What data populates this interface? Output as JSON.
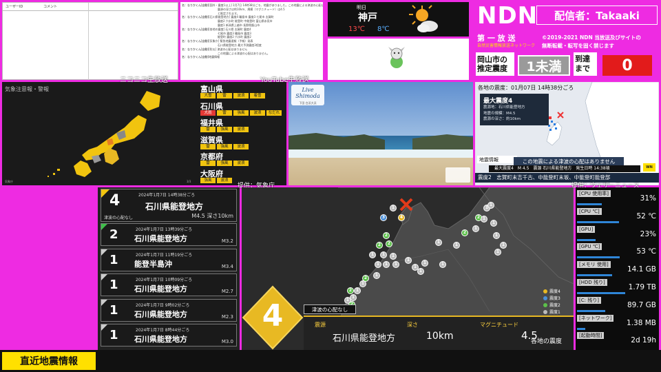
{
  "comments": {
    "col_user": "ユーザーID",
    "col_comment": "コメント"
  },
  "log": [
    {
      "who": "名：なりかくん[自動]",
      "text": "[国外・震度1以上] 1月7日 14時38分ごろ、地震がありました。この地震による津波の心配はありません。"
    },
    {
      "who": "",
      "text": "　　　　　　　　　　　　　震源の深さは約10km、規模（マグニチュード）は4.5"
    },
    {
      "who": "",
      "text": "　　　　　　　　　　　　　と推定されます。"
    },
    {
      "who": "名：なりかくん[自動]",
      "text": "[石川県能登地方] 震度4 輪島市 震度3 七尾市 志賀町"
    },
    {
      "who": "",
      "text": "　　　　　　　　　　　　　震度2 穴水町 能登町 中能登町 富山県氷見市"
    },
    {
      "who": "",
      "text": "　　　　　　　　　　　　　震度1 新潟県上越市 長野県飯山市"
    },
    {
      "who": "名：なりかくん[自動]",
      "text": "[各地の震度] 石川県 志賀町 震度4"
    },
    {
      "who": "",
      "text": "　　　　　　　　　　　　　七尾市 震度3 輪島市 震度3"
    },
    {
      "who": "",
      "text": "　　　　　　　　　　　　　能登町 震度2 穴水町 震度2"
    },
    {
      "who": "名：なりかくん[自動]",
      "text": "[気象庁] 緊急地震速報（予報）発表"
    },
    {
      "who": "",
      "text": "　　　　　　　　　　　　　石川県能登地方 最大予測震度3程度"
    },
    {
      "who": "名：なりかくん[自動]",
      "text": "[防災] 津波の心配はありません"
    },
    {
      "who": "",
      "text": "　　　　　　　　　　　　　この地震による津波の心配はありません。"
    },
    {
      "who": "名：なりかくん[自動]",
      "text": "地震情報"
    }
  ],
  "weather": {
    "label": "明日",
    "city": "神戸",
    "high": "13℃",
    "low": "8℃",
    "icon": "sun-cloud-icon"
  },
  "ndn": {
    "logo": "NDN",
    "streamer": "配信者：Takaaki",
    "broadcast": "第 一 放 送",
    "subtitle": "自然災害情報放送ネットワーク",
    "copyright": "©2019-2021 NDN 当放送及びサイトの",
    "notice": "無断転載・転写を固く禁じます",
    "est_label": "岡山市の推定震度",
    "est_value": "1未満",
    "arrival_label": "到達まで",
    "arrival_value": "0"
  },
  "labels": {
    "niconico": "ニコニコ生放送",
    "youtube": "YouTube生放送",
    "source_jma": "提供：気象庁",
    "source_wn": "提供：ウェザーニュース"
  },
  "warn_map": {
    "title": "気象注意報・警報",
    "page": "3/3",
    "prefectures": [
      {
        "name": "富山県",
        "tags": [
          "大雪",
          "雷",
          "波浪",
          "着雪"
        ]
      },
      {
        "name": "石川県",
        "tags": [
          "大雨",
          "雷",
          "強風",
          "波浪",
          "なだれ"
        ]
      },
      {
        "name": "福井県",
        "tags": [
          "雷",
          "強風",
          "波浪"
        ]
      },
      {
        "name": "滋賀県",
        "tags": [
          "雷",
          "強風",
          "波浪"
        ]
      },
      {
        "name": "京都府",
        "tags": [
          "雷",
          "強風",
          "波浪"
        ]
      },
      {
        "name": "大阪府",
        "tags": [
          "強風",
          "波浪"
        ]
      }
    ]
  },
  "webcam": {
    "logo": "Live Shimoda",
    "sub": "下田 白浜大浜"
  },
  "quake_news": {
    "header": "各地の震度：01月07日 14時38分ごろ",
    "max_label": "最大震度4",
    "rows": [
      "震源地：石川県能登地方",
      "地震の規模：M4.5",
      "震源の深さ：約10km"
    ],
    "info_label": "地震情報",
    "tsunami": "この地震による津波の心配はありません",
    "ticker": "最大震度4　M 4.5　震源 石川県能登地方　発生日時 14:38頃",
    "scroll": "震度2　志賀町末吉千古、中能登町末坂、中能登町能登部"
  },
  "quake_list": [
    {
      "intensity": "4",
      "date": "2024年1月7日 14時38分ごろ",
      "place": "石川県能登地方",
      "tsunami": "津波の心配なし",
      "mag": "M4.5 深さ10km",
      "accent": "#f1c40f"
    },
    {
      "intensity": "2",
      "date": "2024年1月7日 13時39分ごろ",
      "place": "石川県能登地方",
      "mag": "M3.2",
      "accent": "#3fbf4a"
    },
    {
      "intensity": "1",
      "date": "2024年1月7日 11時19分ごろ",
      "place": "能登半島沖",
      "mag": "M3.4",
      "accent": "#cccccc"
    },
    {
      "intensity": "1",
      "date": "2024年1月7日 10時09分ごろ",
      "place": "石川県能登地方",
      "mag": "M2.7",
      "accent": "#cccccc"
    },
    {
      "intensity": "1",
      "date": "2024年1月7日 9時02分ごろ",
      "place": "石川県能登地方",
      "mag": "M2.3",
      "accent": "#cccccc"
    },
    {
      "intensity": "1",
      "date": "2024年1月7日 8時44分ごろ",
      "place": "石川県能登地方",
      "mag": "M3.0",
      "accent": "#cccccc"
    }
  ],
  "big_map": {
    "intensity": "4",
    "tsunami": "津波の心配なし",
    "epicenter_label": "震源",
    "epicenter": "石川県能登地方",
    "depth_label": "深さ",
    "depth": "10km",
    "mag_label": "マグニチュード",
    "mag": "4.5",
    "corner": "各地の震度",
    "legend": [
      {
        "label": "震度4",
        "color": "#e8b923"
      },
      {
        "label": "震度3",
        "color": "#4a8fd8"
      },
      {
        "label": "震度2",
        "color": "#5cc04a"
      },
      {
        "label": "震度1",
        "color": "#bbbbbb"
      }
    ]
  },
  "system": [
    {
      "label": "[CPU 使用率]",
      "value": "31%",
      "bar": 0.31
    },
    {
      "label": "[CPU ℃]",
      "value": "52 ℃",
      "bar": 0.52
    },
    {
      "label": "[GPU]",
      "value": "23%",
      "bar": 0.23
    },
    {
      "label": "[GPU ℃]",
      "value": "53 ℃",
      "bar": 0.53
    },
    {
      "label": "[メモリ 使用]",
      "value": "14.1 GB",
      "bar": 0.44
    },
    {
      "label": "[HDD 残り]",
      "value": "1.79 TB",
      "bar": 0.6
    },
    {
      "label": "[C: 残り]",
      "value": "89.7 GB",
      "bar": 0.35
    },
    {
      "label": "[ネットワーク]",
      "value": "1.38 MB",
      "bar": 0.1
    },
    {
      "label": "[起動時間]",
      "value": "2d 19h",
      "bar": 0
    }
  ],
  "bottom": {
    "title": "直近地震情報"
  }
}
